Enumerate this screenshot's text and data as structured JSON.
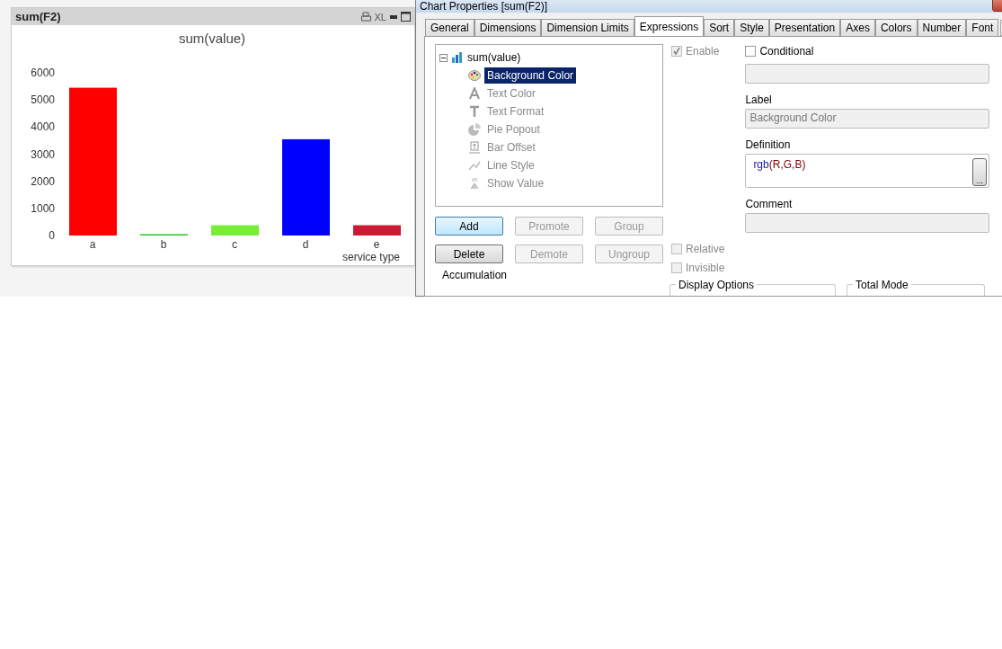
{
  "chart_window": {
    "title": "sum(F2)",
    "xl_label": "XL",
    "chart_data": {
      "type": "bar",
      "title": "sum(value)",
      "xlabel": "service type",
      "stacked": true,
      "categories": [
        "a",
        "b",
        "c",
        "d",
        "e"
      ],
      "series": [
        {
          "color": "#ff0000",
          "values": [
            5450,
            null,
            null,
            null,
            null
          ]
        },
        {
          "color": "#22cc22",
          "values": [
            null,
            50,
            null,
            null,
            null
          ]
        },
        {
          "color": "#77ee33",
          "values": [
            null,
            null,
            380,
            null,
            null
          ]
        },
        {
          "color": "#0000ff",
          "values": [
            null,
            null,
            null,
            3550,
            null
          ]
        },
        {
          "color": "#cc1a33",
          "values": [
            null,
            null,
            null,
            null,
            380
          ]
        }
      ],
      "ylim": [
        0,
        6000
      ],
      "yticks": [
        0,
        1000,
        2000,
        3000,
        4000,
        5000,
        6000
      ]
    }
  },
  "dialog": {
    "title": "Chart Properties [sum(F2)]",
    "tabs": [
      {
        "label": "General",
        "selected": false
      },
      {
        "label": "Dimensions",
        "selected": false
      },
      {
        "label": "Dimension Limits",
        "selected": false
      },
      {
        "label": "Expressions",
        "selected": true
      },
      {
        "label": "Sort",
        "selected": false
      },
      {
        "label": "Style",
        "selected": false
      },
      {
        "label": "Presentation",
        "selected": false
      },
      {
        "label": "Axes",
        "selected": false
      },
      {
        "label": "Colors",
        "selected": false
      },
      {
        "label": "Number",
        "selected": false
      },
      {
        "label": "Font",
        "selected": false
      }
    ],
    "tree": [
      {
        "label": "sum(value)",
        "expanded": true,
        "selected": false,
        "disabled": false,
        "children": [
          {
            "label": "Background Color",
            "selected": true,
            "disabled": false
          },
          {
            "label": "Text Color",
            "selected": false,
            "disabled": true
          },
          {
            "label": "Text Format",
            "selected": false,
            "disabled": true
          },
          {
            "label": "Pie Popout",
            "selected": false,
            "disabled": true
          },
          {
            "label": "Bar Offset",
            "selected": false,
            "disabled": true
          },
          {
            "label": "Line Style",
            "selected": false,
            "disabled": true
          },
          {
            "label": "Show Value",
            "selected": false,
            "disabled": true
          }
        ]
      }
    ],
    "buttons": [
      {
        "label": "Add",
        "disabled": false
      },
      {
        "label": "Promote",
        "disabled": true
      },
      {
        "label": "Group",
        "disabled": true
      },
      {
        "label": "Delete",
        "disabled": false
      },
      {
        "label": "Demote",
        "disabled": true
      },
      {
        "label": "Ungroup",
        "disabled": true
      }
    ],
    "accumulation_label": "Accumulation",
    "enable": {
      "label": "Enable",
      "checked": true,
      "disabled": true
    },
    "conditional": {
      "label": "Conditional",
      "checked": false,
      "disabled": false
    },
    "label_caption": "Label",
    "label_value": "Background Color",
    "definition_caption": "Definition",
    "definition": {
      "function": "rgb",
      "args": "(R,G,B)"
    },
    "definition_button": "...",
    "comment_caption": "Comment",
    "relative": {
      "label": "Relative",
      "checked": false,
      "disabled": true
    },
    "invisible": {
      "label": "Invisible",
      "checked": false,
      "disabled": true
    },
    "display_options_label": "Display Options",
    "total_mode_label": "Total Mode"
  }
}
